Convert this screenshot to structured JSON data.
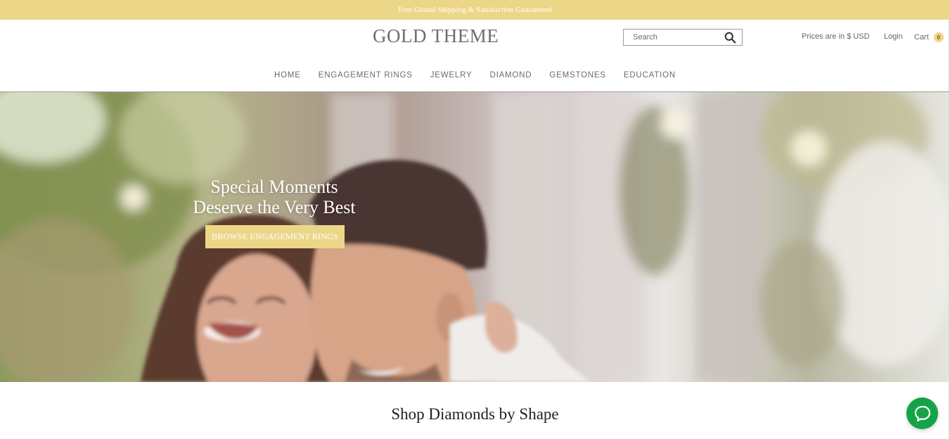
{
  "announcement": "Free Global Shipping & Satisfaction Guaranteed",
  "header": {
    "logo": "GOLD THEME",
    "search_placeholder": "Search",
    "prices": "Prices are in $ USD",
    "login": "Login",
    "cart_label": "Cart",
    "cart_count": "0"
  },
  "nav": {
    "items": [
      "HOME",
      "ENGAGEMENT RINGS",
      "JEWELRY",
      "DIAMOND",
      "GEMSTONES",
      "EDUCATION"
    ]
  },
  "hero": {
    "title_line1": "Special Moments",
    "title_line2": "Deserve the Very Best",
    "button": "BROWSE ENGAGEMENT RINGS"
  },
  "section": {
    "title": "Shop Diamonds by Shape"
  },
  "colors": {
    "accent": "#ecd788",
    "chat": "#14a447"
  },
  "icons": {
    "search": "search-icon",
    "chat": "chat-icon"
  }
}
